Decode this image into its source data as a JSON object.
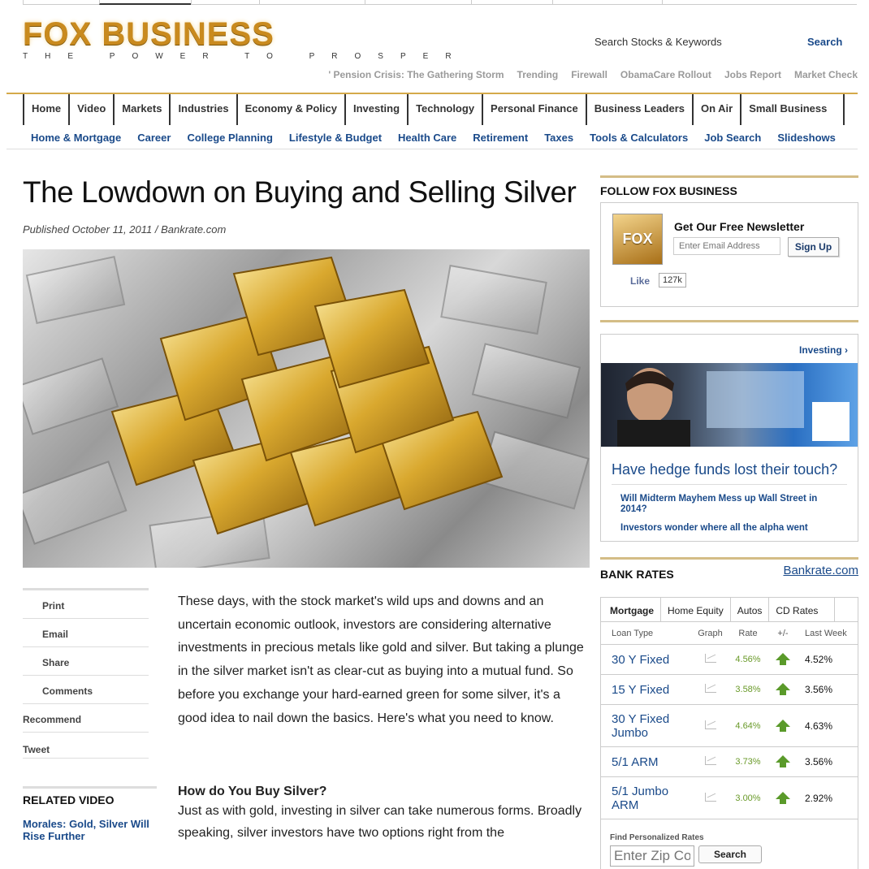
{
  "logo": {
    "word": "FOX BUSINESS",
    "tagline": "THE POWER TO PROSPER"
  },
  "search": {
    "label": "Search Stocks & Keywords",
    "button": "Search"
  },
  "trending": [
    "' Pension Crisis: The Gathering Storm",
    "Trending",
    "Firewall",
    "ObamaCare Rollout",
    "Jobs Report",
    "Market Check"
  ],
  "mainnav": [
    "Home",
    "Video",
    "Markets",
    "Industries",
    "Economy & Policy",
    "Investing",
    "Technology",
    "Personal Finance",
    "Business Leaders",
    "On Air",
    "Small Business"
  ],
  "subnav": [
    "Home & Mortgage",
    "Career",
    "College Planning",
    "Lifestyle & Budget",
    "Health Care",
    "Retirement",
    "Taxes",
    "Tools & Calculators",
    "Job Search",
    "Slideshows"
  ],
  "article": {
    "title": "The Lowdown on Buying and Selling Silver",
    "published": "Published October 11, 2011  /  Bankrate.com",
    "para1": "These days, with the stock market's wild ups and downs and an uncertain economic outlook, investors are considering alternative investments in precious metals like gold and silver. But taking a plunge in the silver market isn't as clear-cut as buying into a mutual fund. So before you exchange your hard-earned green for some silver, it's a good idea to nail down the basics. Here's what you need to know.",
    "heading2": "How do You Buy Silver?",
    "para2": "Just as with gold, investing in silver can take numerous forms. Broadly speaking, silver investors have two options right from the"
  },
  "tools": [
    "Print",
    "Email",
    "Share",
    "Comments",
    "Recommend",
    "Tweet"
  ],
  "related": {
    "heading": "RELATED VIDEO",
    "link": "Morales: Gold, Silver Will Rise Further"
  },
  "follow": {
    "heading": "FOLLOW FOX BUSINESS",
    "logo_text": "FOX",
    "newsletter_title": "Get Our Free Newsletter",
    "email_placeholder": "Enter Email Address",
    "signup": "Sign Up",
    "like": "Like",
    "like_count": "127k"
  },
  "investing": {
    "link": "Investing ›",
    "headline": "Have hedge funds lost their touch?",
    "sub1": "Will Midterm Mayhem Mess up Wall Street in 2014?",
    "sub2": "Investors wonder where all the alpha went"
  },
  "bank_rates": {
    "heading": "BANK RATES",
    "brand": "Bankrate.com",
    "tabs": [
      "Mortgage",
      "Home Equity",
      "Autos",
      "CD Rates"
    ],
    "columns": [
      "Loan Type",
      "Graph",
      "Rate",
      "+/-",
      "Last Week"
    ],
    "rows": [
      {
        "type": "30 Y Fixed",
        "rate": "4.56%",
        "change": "up",
        "last": "4.52%"
      },
      {
        "type": "15 Y Fixed",
        "rate": "3.58%",
        "change": "up",
        "last": "3.56%"
      },
      {
        "type": "30 Y Fixed Jumbo",
        "rate": "4.64%",
        "change": "up",
        "last": "4.63%"
      },
      {
        "type": "5/1 ARM",
        "rate": "3.73%",
        "change": "up",
        "last": "3.56%"
      },
      {
        "type": "5/1 Jumbo ARM",
        "rate": "3.00%",
        "change": "up",
        "last": "2.92%"
      }
    ],
    "find_label": "Find Personalized Rates",
    "zip_placeholder": "Enter Zip Code",
    "search": "Search"
  },
  "colors": {
    "accent_gold": "#d4a94a",
    "link_blue": "#1a4a8a",
    "rate_green": "#6a9a2a"
  }
}
